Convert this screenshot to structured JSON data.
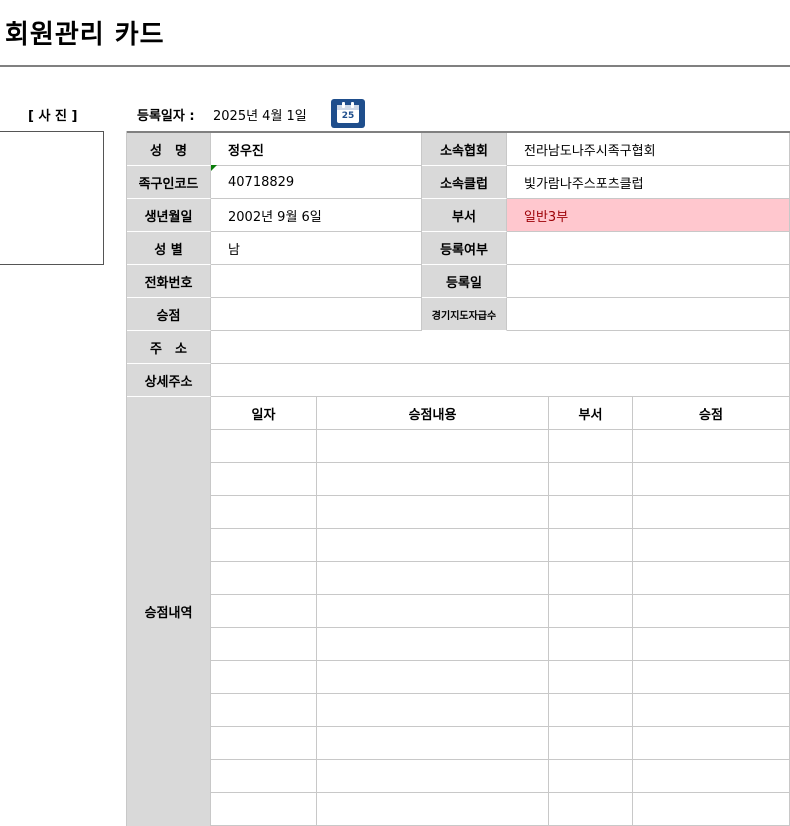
{
  "page_title": "회원관리 카드",
  "photo_label": "[ 사 진 ]",
  "registration": {
    "label": "등록일자 :",
    "date": "2025년 4월 1일",
    "calendar_icon_text": "25"
  },
  "fields": {
    "name": {
      "label": "성　명",
      "value": "정우진"
    },
    "association": {
      "label": "소속협회",
      "value": "전라남도나주시족구협회"
    },
    "code": {
      "label": "족구인코드",
      "value": "40718829"
    },
    "club": {
      "label": "소속클럽",
      "value": "빛가람나주스포츠클럽"
    },
    "birth": {
      "label": "생년월일",
      "value": "2002년 9월 6일"
    },
    "division": {
      "label": "부서",
      "value": "일반3부"
    },
    "gender": {
      "label": "성 별",
      "value": "남"
    },
    "registered": {
      "label": "등록여부",
      "value": ""
    },
    "phone": {
      "label": "전화번호",
      "value": ""
    },
    "reg_day": {
      "label": "등록일",
      "value": ""
    },
    "promotion": {
      "label": "승점",
      "value": ""
    },
    "gyeonggi": {
      "label": "경기지도자급수",
      "value": ""
    },
    "address": {
      "label": "주　소",
      "value": ""
    },
    "address_detail": {
      "label": "상세주소",
      "value": ""
    }
  },
  "history": {
    "label": "승점내역",
    "columns": [
      "일자",
      "승점내용",
      "부서",
      "승점"
    ],
    "row_count": 12
  }
}
